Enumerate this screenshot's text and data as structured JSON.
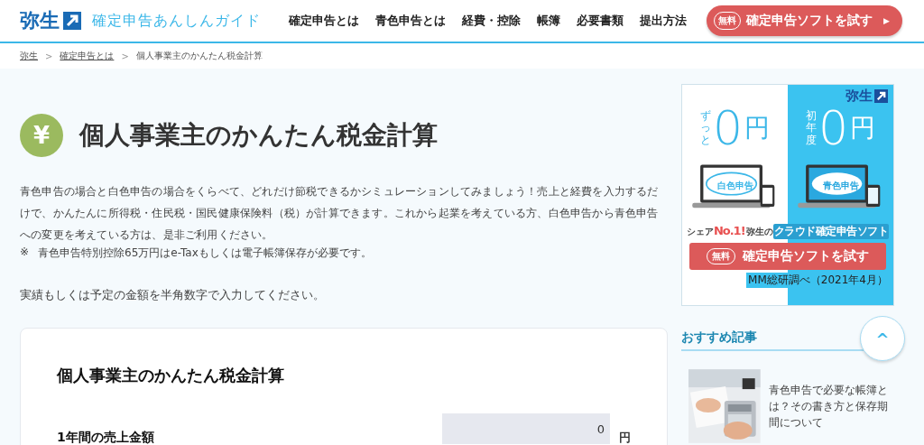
{
  "header": {
    "logo": "弥生",
    "site_title": "確定申告あんしんガイド",
    "nav": [
      {
        "label": "確定申告とは"
      },
      {
        "label": "青色申告とは"
      },
      {
        "label": "経費・控除"
      },
      {
        "label": "帳簿"
      },
      {
        "label": "必要書類"
      },
      {
        "label": "提出方法"
      }
    ],
    "cta": {
      "badge": "無料",
      "label": "確定申告ソフトを試す",
      "arrow": "▶"
    }
  },
  "breadcrumb": [
    {
      "label": "弥生",
      "link": true
    },
    {
      "label": "確定申告とは",
      "link": true
    },
    {
      "label": "個人事業主のかんたん税金計算",
      "link": false
    }
  ],
  "breadcrumb_separator": ">",
  "page": {
    "icon": "¥",
    "title": "個人事業主のかんたん税金計算",
    "intro": "青色申告の場合と白色申告の場合をくらべて、どれだけ節税できるかシミュレーションしてみましょう！売上と経費を入力するだけで、かんたんに所得税・住民税・国民健康保険料（税）が計算できます。これから起業を考えている方、白色申告から青色申告への変更を考えている方は、是非ご利用ください。",
    "note_mark": "※",
    "note": "青色申告特別控除65万円はe-Taxもしくは電子帳簿保存が必要です。",
    "instruction": "実績もしくは予定の金額を半角数字で入力してください。"
  },
  "calculator": {
    "title": "個人事業主のかんたん税金計算",
    "fields": [
      {
        "label": "1年間の売上金額",
        "value": "0",
        "unit": "円"
      }
    ]
  },
  "ad": {
    "logo": "弥生",
    "left": {
      "prefix": "ずっと",
      "amount": "0",
      "unit": "円",
      "screen": "白色申告"
    },
    "right": {
      "prefix": "初年度",
      "amount": "0",
      "unit": "円",
      "screen": "青色申告"
    },
    "tagline_pre": "シェア",
    "tagline_em": "No.1!",
    "tagline_mid": "弥生の",
    "tagline_post": "クラウド確定申告ソフト",
    "button_badge": "無料",
    "button_label": "確定申告ソフトを試す",
    "source": "MM総研調べ（2021年4月）"
  },
  "recommended": {
    "heading": "おすすめ記事",
    "articles": [
      {
        "title": "青色申告で必要な帳簿とは？その書き方と保存期間について"
      }
    ]
  },
  "scroll_top": "^"
}
